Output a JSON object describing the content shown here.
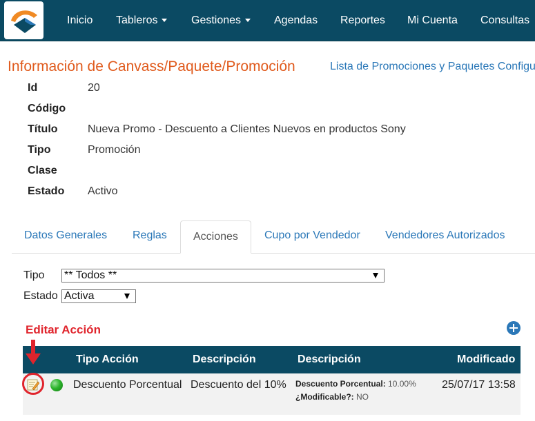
{
  "nav": {
    "items": [
      {
        "label": "Inicio",
        "dropdown": false
      },
      {
        "label": "Tableros",
        "dropdown": true
      },
      {
        "label": "Gestiones",
        "dropdown": true
      },
      {
        "label": "Agendas",
        "dropdown": false
      },
      {
        "label": "Reportes",
        "dropdown": false
      },
      {
        "label": "Mi Cuenta",
        "dropdown": false
      },
      {
        "label": "Consultas",
        "dropdown": false
      }
    ]
  },
  "header": {
    "title": "Información de Canvass/Paquete/Promoción",
    "list_link": "Lista de Promociones y Paquetes Configur"
  },
  "details": [
    {
      "label": "Id",
      "value": "20"
    },
    {
      "label": "Código",
      "value": ""
    },
    {
      "label": "Título",
      "value": "Nueva Promo - Descuento a Clientes Nuevos en productos Sony"
    },
    {
      "label": "Tipo",
      "value": "Promoción"
    },
    {
      "label": "Clase",
      "value": ""
    },
    {
      "label": "Estado",
      "value": "Activo"
    }
  ],
  "tabs": [
    {
      "label": "Datos Generales",
      "active": false
    },
    {
      "label": "Reglas",
      "active": false
    },
    {
      "label": "Acciones",
      "active": true
    },
    {
      "label": "Cupo por Vendedor",
      "active": false
    },
    {
      "label": "Vendedores Autorizados",
      "active": false
    }
  ],
  "filters": {
    "tipo_label": "Tipo",
    "tipo_value": "** Todos **",
    "estado_label": "Estado",
    "estado_value": "Activa"
  },
  "section": {
    "title": "Editar Acción"
  },
  "table": {
    "headers": [
      "Tipo Acción",
      "Descripción",
      "Descripción",
      "Modificado"
    ],
    "rows": [
      {
        "status": "active",
        "tipo_accion": "Descuento Porcentual",
        "descripcion": "Descuento del 10%",
        "detail_label_1": "Descuento Porcentual:",
        "detail_value_1": "10.00%",
        "detail_label_2": "¿Modificable?:",
        "detail_value_2": "NO",
        "modificado": "25/07/17 13:58"
      }
    ]
  },
  "colors": {
    "navbar": "#0b4a63",
    "title_orange": "#e05a1c",
    "link_blue": "#2b78b8",
    "accent_red": "#e0242c",
    "status_green": "#2cb52c"
  }
}
